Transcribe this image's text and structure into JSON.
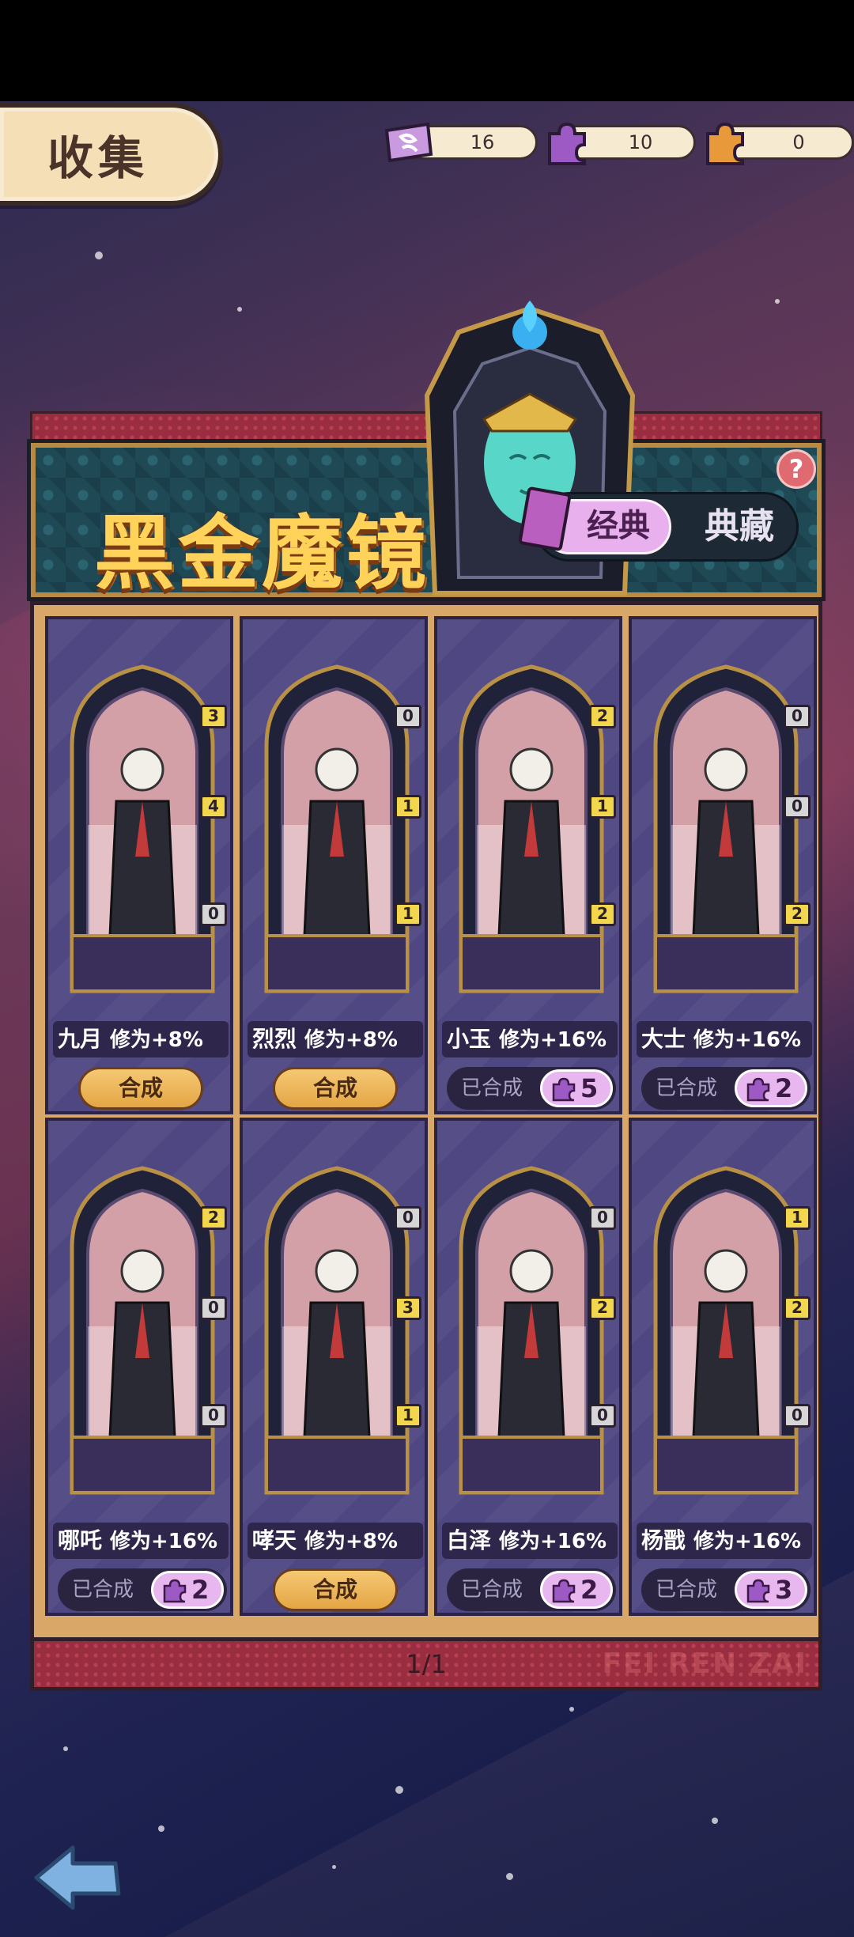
{
  "header": {
    "tab_label": "收集",
    "currencies": [
      {
        "icon": "ticket-icon",
        "value": "16",
        "color": "#b87ad4"
      },
      {
        "icon": "purple-puzzle-icon",
        "value": "10",
        "color": "#9d5ac4"
      },
      {
        "icon": "orange-puzzle-icon",
        "value": "0",
        "color": "#e89a3a"
      }
    ]
  },
  "banner": {
    "title": "黑金魔镜",
    "help": "?",
    "tabs": {
      "active": "经典",
      "inactive": "典藏"
    }
  },
  "cards": [
    {
      "name": "九月",
      "bonus": "修为+8%",
      "badges": [
        "3",
        "4",
        "0"
      ],
      "badge_colors": [
        "y",
        "y",
        "g"
      ],
      "state": "combine",
      "action": "合成"
    },
    {
      "name": "烈烈",
      "bonus": "修为+8%",
      "badges": [
        "0",
        "1",
        "1"
      ],
      "badge_colors": [
        "g",
        "y",
        "y"
      ],
      "state": "combine",
      "action": "合成"
    },
    {
      "name": "小玉",
      "bonus": "修为+16%",
      "badges": [
        "2",
        "1",
        "2"
      ],
      "badge_colors": [
        "y",
        "y",
        "y"
      ],
      "state": "done",
      "action": "已合成",
      "pieces": "5"
    },
    {
      "name": "大士",
      "bonus": "修为+16%",
      "badges": [
        "0",
        "0",
        "2"
      ],
      "badge_colors": [
        "g",
        "g",
        "y"
      ],
      "state": "done",
      "action": "已合成",
      "pieces": "2"
    },
    {
      "name": "哪吒",
      "bonus": "修为+16%",
      "badges": [
        "2",
        "0",
        "0"
      ],
      "badge_colors": [
        "y",
        "g",
        "g"
      ],
      "state": "done",
      "action": "已合成",
      "pieces": "2"
    },
    {
      "name": "哮天",
      "bonus": "修为+8%",
      "badges": [
        "0",
        "3",
        "1"
      ],
      "badge_colors": [
        "g",
        "y",
        "y"
      ],
      "state": "combine",
      "action": "合成"
    },
    {
      "name": "白泽",
      "bonus": "修为+16%",
      "badges": [
        "0",
        "2",
        "0"
      ],
      "badge_colors": [
        "g",
        "y",
        "g"
      ],
      "state": "done",
      "action": "已合成",
      "pieces": "2"
    },
    {
      "name": "杨戬",
      "bonus": "修为+16%",
      "badges": [
        "1",
        "2",
        "0"
      ],
      "badge_colors": [
        "y",
        "y",
        "g"
      ],
      "state": "done",
      "action": "已合成",
      "pieces": "3"
    }
  ],
  "footer": {
    "page": "1/1",
    "watermark": "FEI REN ZAI"
  },
  "colors": {
    "card_bg": "#4f4782",
    "badge_yellow": "#f1d64e",
    "badge_grey": "#d6d6d6",
    "title_gold": "#ffd35a"
  }
}
